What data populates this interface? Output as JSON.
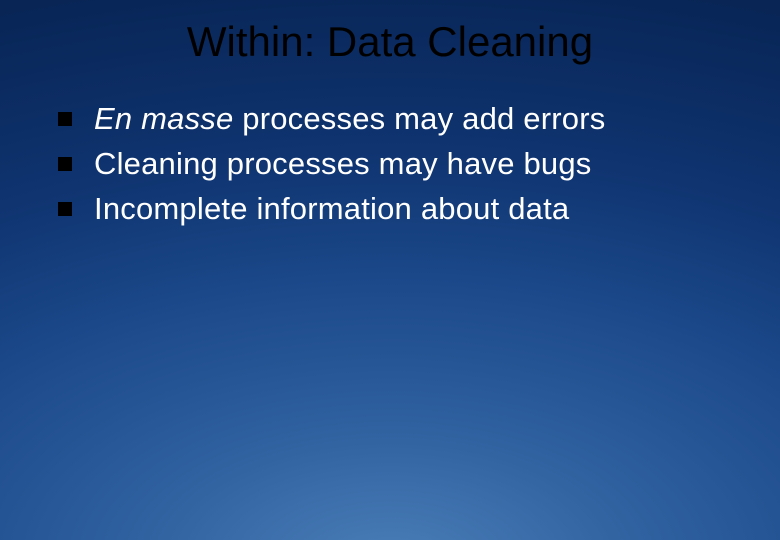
{
  "title": "Within: Data Cleaning",
  "bullets": [
    {
      "italic_prefix": "En masse",
      "rest": " processes may add errors"
    },
    {
      "italic_prefix": "",
      "rest": "Cleaning processes may have bugs"
    },
    {
      "italic_prefix": "",
      "rest": "Incomplete information about data"
    }
  ]
}
